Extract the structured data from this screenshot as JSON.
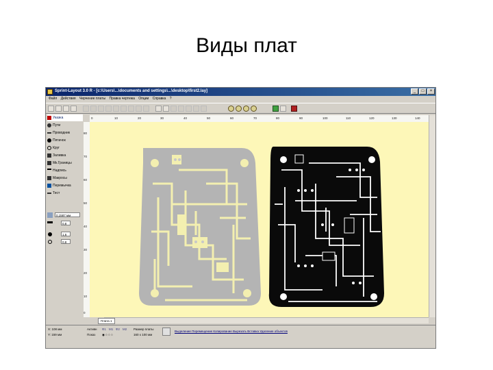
{
  "slide": {
    "title": "Виды плат"
  },
  "window": {
    "title": "Sprint-Layout 3.0 R - [c:\\Users\\...\\documents and settings\\...\\desktop\\first2.lay]",
    "controls": {
      "minimize": "_",
      "maximize": "□",
      "close": "×"
    }
  },
  "menu": [
    "Файл",
    "Действия",
    "Черчение платы",
    "Правка чертежа",
    "Опции",
    "Справка",
    "?"
  ],
  "tools": [
    {
      "label": "Указка",
      "icon": "pointer-icon"
    },
    {
      "label": "Пути",
      "icon": "zoom-icon"
    },
    {
      "label": "Проводник",
      "icon": "track-icon"
    },
    {
      "label": "Пятачок",
      "icon": "pad-icon"
    },
    {
      "label": "Круг",
      "icon": "circle-icon"
    },
    {
      "label": "Заливка",
      "icon": "fill-icon"
    },
    {
      "label": "Мк.Границы",
      "icon": "border-icon"
    },
    {
      "label": "Надпись",
      "icon": "text-icon"
    },
    {
      "label": "Макросы",
      "icon": "macro-icon"
    },
    {
      "label": "Перемычка",
      "icon": "jumper-icon"
    },
    {
      "label": "Тест",
      "icon": "test-icon"
    }
  ],
  "grid": {
    "value": "0,1587 мм"
  },
  "params": [
    {
      "value": "0,8"
    },
    {
      "value": "1,6"
    },
    {
      "value": "0,8"
    }
  ],
  "ruler_h": [
    "0",
    "10",
    "20",
    "30",
    "40",
    "50",
    "60",
    "70",
    "80",
    "90",
    "100",
    "110",
    "120",
    "130",
    "140",
    "150",
    "160"
  ],
  "ruler_v": [
    "80",
    "70",
    "60",
    "50",
    "40",
    "30",
    "20",
    "10",
    "0"
  ],
  "page_tab": "Плата 1",
  "status": {
    "x": "X: 108 мм",
    "y": "Y: 159 мм",
    "active_label": "Активн",
    "layers_label": "Показ",
    "layers": [
      "Ф1",
      "М1",
      "Ф2",
      "М2"
    ],
    "size_label": "Размер платы",
    "size_value": "160 x 100 мм",
    "hint": "Выделение Перемещение Копирование Вырезать Вставка Удаление объектов"
  },
  "colors": {
    "canvas": "#fdf7b8",
    "board_gray": "#b4b4b4",
    "track_yellow": "#f3efb0",
    "board_black": "#0a0a0a"
  }
}
